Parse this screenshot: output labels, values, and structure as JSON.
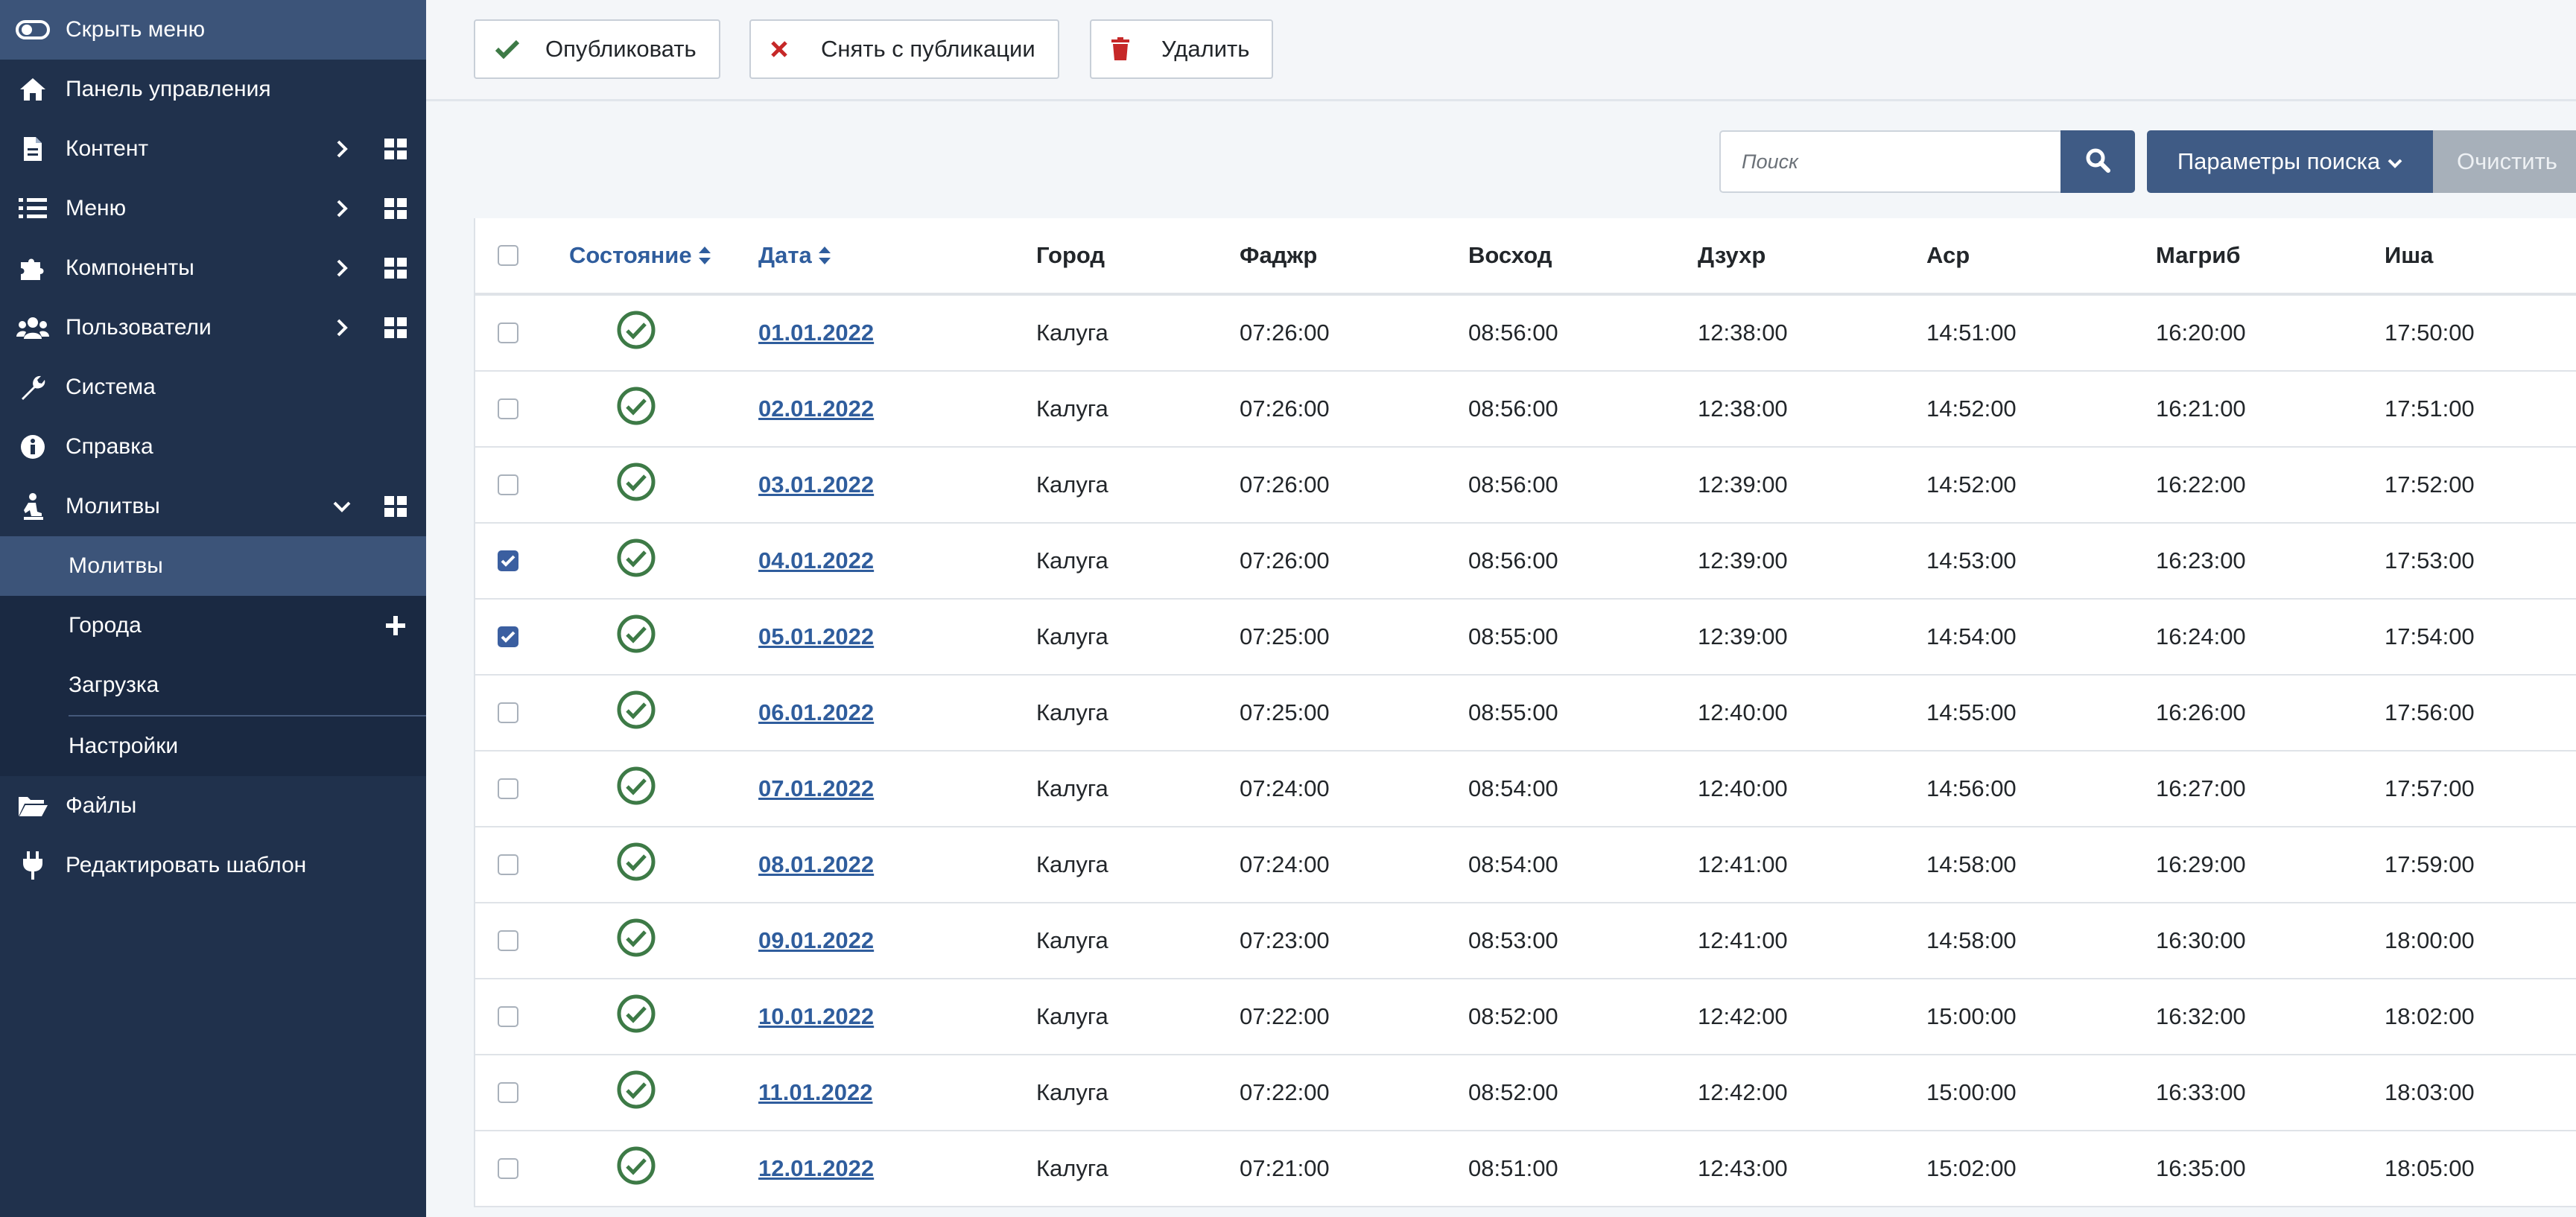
{
  "sidebar": {
    "hide_label": "Скрыть меню",
    "items": [
      {
        "label": "Панель управления",
        "icon": "home-icon"
      },
      {
        "label": "Контент",
        "icon": "file-icon"
      },
      {
        "label": "Меню",
        "icon": "list-icon"
      },
      {
        "label": "Компоненты",
        "icon": "puzzle-icon"
      },
      {
        "label": "Пользователи",
        "icon": "users-icon"
      },
      {
        "label": "Система",
        "icon": "wrench-icon"
      },
      {
        "label": "Справка",
        "icon": "info-icon"
      },
      {
        "label": "Молитвы",
        "icon": "pray-icon"
      }
    ],
    "submenu": [
      {
        "label": "Молитвы"
      },
      {
        "label": "Города"
      },
      {
        "label": "Загрузка"
      },
      {
        "label": "Настройки"
      }
    ],
    "bottom": [
      {
        "label": "Файлы",
        "icon": "folder-icon"
      },
      {
        "label": "Редактировать шаблон",
        "icon": "plug-icon"
      }
    ]
  },
  "toolbar": {
    "publish_label": "Опубликовать",
    "unpublish_label": "Снять с публикации",
    "delete_label": "Удалить"
  },
  "search": {
    "placeholder": "Поиск",
    "params_label": "Параметры поиска",
    "clear_label": "Очистить"
  },
  "table": {
    "columns": [
      "Состояние",
      "Дата",
      "Город",
      "Фаджр",
      "Восход",
      "Дзухр",
      "Аср",
      "Магриб",
      "Иша"
    ],
    "rows": [
      {
        "checked": false,
        "date": "01.01.2022",
        "city": "Калуга",
        "fajr": "07:26:00",
        "sunrise": "08:56:00",
        "dhuhr": "12:38:00",
        "asr": "14:51:00",
        "maghrib": "16:20:00",
        "isha": "17:50:00"
      },
      {
        "checked": false,
        "date": "02.01.2022",
        "city": "Калуга",
        "fajr": "07:26:00",
        "sunrise": "08:56:00",
        "dhuhr": "12:38:00",
        "asr": "14:52:00",
        "maghrib": "16:21:00",
        "isha": "17:51:00"
      },
      {
        "checked": false,
        "date": "03.01.2022",
        "city": "Калуга",
        "fajr": "07:26:00",
        "sunrise": "08:56:00",
        "dhuhr": "12:39:00",
        "asr": "14:52:00",
        "maghrib": "16:22:00",
        "isha": "17:52:00"
      },
      {
        "checked": true,
        "date": "04.01.2022",
        "city": "Калуга",
        "fajr": "07:26:00",
        "sunrise": "08:56:00",
        "dhuhr": "12:39:00",
        "asr": "14:53:00",
        "maghrib": "16:23:00",
        "isha": "17:53:00"
      },
      {
        "checked": true,
        "date": "05.01.2022",
        "city": "Калуга",
        "fajr": "07:25:00",
        "sunrise": "08:55:00",
        "dhuhr": "12:39:00",
        "asr": "14:54:00",
        "maghrib": "16:24:00",
        "isha": "17:54:00"
      },
      {
        "checked": false,
        "date": "06.01.2022",
        "city": "Калуга",
        "fajr": "07:25:00",
        "sunrise": "08:55:00",
        "dhuhr": "12:40:00",
        "asr": "14:55:00",
        "maghrib": "16:26:00",
        "isha": "17:56:00"
      },
      {
        "checked": false,
        "date": "07.01.2022",
        "city": "Калуга",
        "fajr": "07:24:00",
        "sunrise": "08:54:00",
        "dhuhr": "12:40:00",
        "asr": "14:56:00",
        "maghrib": "16:27:00",
        "isha": "17:57:00"
      },
      {
        "checked": false,
        "date": "08.01.2022",
        "city": "Калуга",
        "fajr": "07:24:00",
        "sunrise": "08:54:00",
        "dhuhr": "12:41:00",
        "asr": "14:58:00",
        "maghrib": "16:29:00",
        "isha": "17:59:00"
      },
      {
        "checked": false,
        "date": "09.01.2022",
        "city": "Калуга",
        "fajr": "07:23:00",
        "sunrise": "08:53:00",
        "dhuhr": "12:41:00",
        "asr": "14:58:00",
        "maghrib": "16:30:00",
        "isha": "18:00:00"
      },
      {
        "checked": false,
        "date": "10.01.2022",
        "city": "Калуга",
        "fajr": "07:22:00",
        "sunrise": "08:52:00",
        "dhuhr": "12:42:00",
        "asr": "15:00:00",
        "maghrib": "16:32:00",
        "isha": "18:02:00"
      },
      {
        "checked": false,
        "date": "11.01.2022",
        "city": "Калуга",
        "fajr": "07:22:00",
        "sunrise": "08:52:00",
        "dhuhr": "12:42:00",
        "asr": "15:00:00",
        "maghrib": "16:33:00",
        "isha": "18:03:00"
      },
      {
        "checked": false,
        "date": "12.01.2022",
        "city": "Калуга",
        "fajr": "07:21:00",
        "sunrise": "08:51:00",
        "dhuhr": "12:43:00",
        "asr": "15:02:00",
        "maghrib": "16:35:00",
        "isha": "18:05:00"
      }
    ]
  },
  "colors": {
    "sidebar_bg": "#20314c",
    "sidebar_active": "#3c5479",
    "accent": "#3f5b85",
    "link": "#2f5d9d",
    "published": "#3d7a46",
    "delete": "#c62828",
    "unpublish": "#c62828"
  }
}
